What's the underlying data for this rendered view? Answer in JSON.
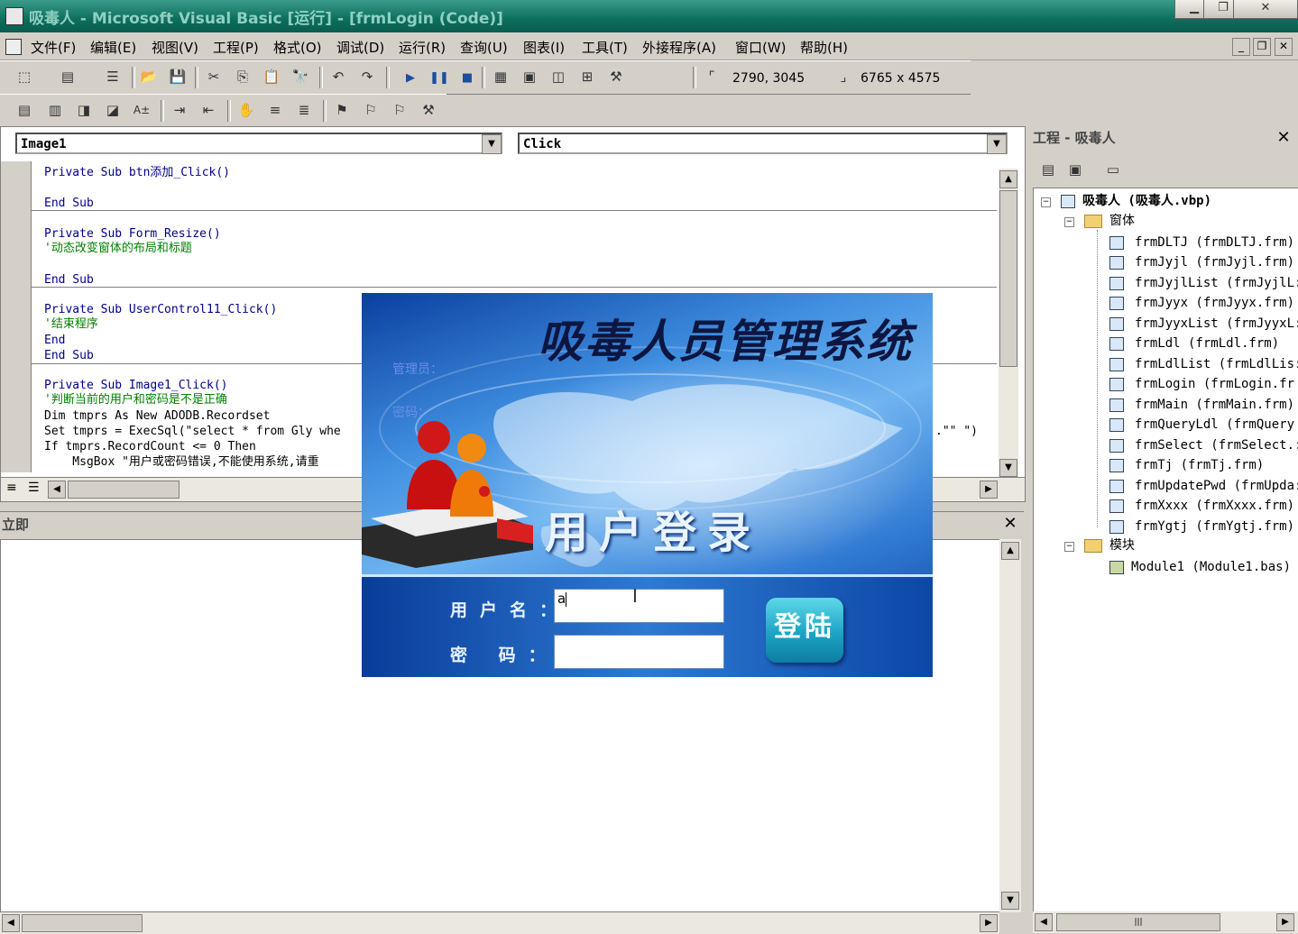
{
  "window": {
    "title": "吸毒人 - Microsoft Visual Basic [运行] - [frmLogin (Code)]"
  },
  "menu": [
    "文件(F)",
    "编辑(E)",
    "视图(V)",
    "工程(P)",
    "格式(O)",
    "调试(D)",
    "运行(R)",
    "查询(U)",
    "图表(I)",
    "工具(T)",
    "外接程序(A)",
    "窗口(W)",
    "帮助(H)"
  ],
  "toolbar": {
    "position": "2790, 3045",
    "size": "6765 x 4575"
  },
  "code": {
    "object_combo": "Image1",
    "proc_combo": "Click",
    "lines": {
      "l1": "Private Sub btn添加_Click()",
      "l2": "End Sub",
      "l3": "Private Sub Form_Resize()",
      "l4": "'动态改变窗体的布局和标题",
      "l5": "End Sub",
      "l6": "Private Sub UserControl11_Click()",
      "l7": "'结束程序",
      "l8": "End",
      "l9": "End Sub",
      "l10": "Private Sub Image1_Click()",
      "l11": "'判断当前的用户和密码是不是正确",
      "l12": "Dim tmprs As New ADODB.Recordset",
      "l13": "Set tmprs = ExecSql(\"select * from Gly whe",
      "l13_tail": ".\"\" \")",
      "l14": "If tmprs.RecordCount <= 0 Then",
      "l15": "    MsgBox \"用户或密码错误,不能使用系统,请重"
    }
  },
  "immediate": {
    "title": "立即"
  },
  "project": {
    "title": "工程 - 吸毒人",
    "root": "吸毒人 (吸毒人.vbp)",
    "forms_folder": "窗体",
    "forms": [
      "frmDLTJ (frmDLTJ.frm)",
      "frmJyjl (frmJyjl.frm)",
      "frmJyjlList (frmJyjlL:",
      "frmJyyx (frmJyyx.frm)",
      "frmJyyxList (frmJyyxL:",
      "frmLdl (frmLdl.frm)",
      "frmLdlList (frmLdlLis:",
      "frmLogin (frmLogin.fr",
      "frmMain (frmMain.frm)",
      "frmQueryLdl (frmQuery",
      "frmSelect (frmSelect.:",
      "frmTj (frmTj.frm)",
      "frmUpdatePwd (frmUpda:",
      "frmXxxx (frmXxxx.frm)",
      "frmYgtj (frmYgtj.frm)"
    ],
    "modules_folder": "模块",
    "modules": [
      "Module1 (Module1.bas)"
    ]
  },
  "login": {
    "title": "吸毒人员管理系统",
    "subtitle": "用户登录",
    "faint_label1": "管理员：",
    "faint_label2": "密码：",
    "username_label": "用户名：",
    "password_label": "密  码：",
    "username_value": "a",
    "password_value": "",
    "login_button": "登陆"
  }
}
